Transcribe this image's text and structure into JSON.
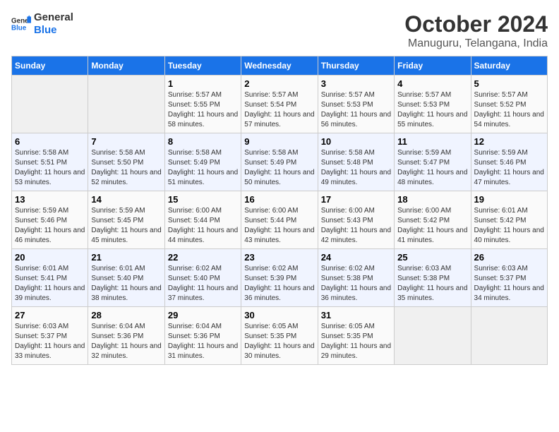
{
  "logo": {
    "general": "General",
    "blue": "Blue"
  },
  "header": {
    "month": "October 2024",
    "location": "Manuguru, Telangana, India"
  },
  "weekdays": [
    "Sunday",
    "Monday",
    "Tuesday",
    "Wednesday",
    "Thursday",
    "Friday",
    "Saturday"
  ],
  "weeks": [
    [
      {
        "day": "",
        "sunrise": "",
        "sunset": "",
        "daylight": ""
      },
      {
        "day": "",
        "sunrise": "",
        "sunset": "",
        "daylight": ""
      },
      {
        "day": "1",
        "sunrise": "Sunrise: 5:57 AM",
        "sunset": "Sunset: 5:55 PM",
        "daylight": "Daylight: 11 hours and 58 minutes."
      },
      {
        "day": "2",
        "sunrise": "Sunrise: 5:57 AM",
        "sunset": "Sunset: 5:54 PM",
        "daylight": "Daylight: 11 hours and 57 minutes."
      },
      {
        "day": "3",
        "sunrise": "Sunrise: 5:57 AM",
        "sunset": "Sunset: 5:53 PM",
        "daylight": "Daylight: 11 hours and 56 minutes."
      },
      {
        "day": "4",
        "sunrise": "Sunrise: 5:57 AM",
        "sunset": "Sunset: 5:53 PM",
        "daylight": "Daylight: 11 hours and 55 minutes."
      },
      {
        "day": "5",
        "sunrise": "Sunrise: 5:57 AM",
        "sunset": "Sunset: 5:52 PM",
        "daylight": "Daylight: 11 hours and 54 minutes."
      }
    ],
    [
      {
        "day": "6",
        "sunrise": "Sunrise: 5:58 AM",
        "sunset": "Sunset: 5:51 PM",
        "daylight": "Daylight: 11 hours and 53 minutes."
      },
      {
        "day": "7",
        "sunrise": "Sunrise: 5:58 AM",
        "sunset": "Sunset: 5:50 PM",
        "daylight": "Daylight: 11 hours and 52 minutes."
      },
      {
        "day": "8",
        "sunrise": "Sunrise: 5:58 AM",
        "sunset": "Sunset: 5:49 PM",
        "daylight": "Daylight: 11 hours and 51 minutes."
      },
      {
        "day": "9",
        "sunrise": "Sunrise: 5:58 AM",
        "sunset": "Sunset: 5:49 PM",
        "daylight": "Daylight: 11 hours and 50 minutes."
      },
      {
        "day": "10",
        "sunrise": "Sunrise: 5:58 AM",
        "sunset": "Sunset: 5:48 PM",
        "daylight": "Daylight: 11 hours and 49 minutes."
      },
      {
        "day": "11",
        "sunrise": "Sunrise: 5:59 AM",
        "sunset": "Sunset: 5:47 PM",
        "daylight": "Daylight: 11 hours and 48 minutes."
      },
      {
        "day": "12",
        "sunrise": "Sunrise: 5:59 AM",
        "sunset": "Sunset: 5:46 PM",
        "daylight": "Daylight: 11 hours and 47 minutes."
      }
    ],
    [
      {
        "day": "13",
        "sunrise": "Sunrise: 5:59 AM",
        "sunset": "Sunset: 5:46 PM",
        "daylight": "Daylight: 11 hours and 46 minutes."
      },
      {
        "day": "14",
        "sunrise": "Sunrise: 5:59 AM",
        "sunset": "Sunset: 5:45 PM",
        "daylight": "Daylight: 11 hours and 45 minutes."
      },
      {
        "day": "15",
        "sunrise": "Sunrise: 6:00 AM",
        "sunset": "Sunset: 5:44 PM",
        "daylight": "Daylight: 11 hours and 44 minutes."
      },
      {
        "day": "16",
        "sunrise": "Sunrise: 6:00 AM",
        "sunset": "Sunset: 5:44 PM",
        "daylight": "Daylight: 11 hours and 43 minutes."
      },
      {
        "day": "17",
        "sunrise": "Sunrise: 6:00 AM",
        "sunset": "Sunset: 5:43 PM",
        "daylight": "Daylight: 11 hours and 42 minutes."
      },
      {
        "day": "18",
        "sunrise": "Sunrise: 6:00 AM",
        "sunset": "Sunset: 5:42 PM",
        "daylight": "Daylight: 11 hours and 41 minutes."
      },
      {
        "day": "19",
        "sunrise": "Sunrise: 6:01 AM",
        "sunset": "Sunset: 5:42 PM",
        "daylight": "Daylight: 11 hours and 40 minutes."
      }
    ],
    [
      {
        "day": "20",
        "sunrise": "Sunrise: 6:01 AM",
        "sunset": "Sunset: 5:41 PM",
        "daylight": "Daylight: 11 hours and 39 minutes."
      },
      {
        "day": "21",
        "sunrise": "Sunrise: 6:01 AM",
        "sunset": "Sunset: 5:40 PM",
        "daylight": "Daylight: 11 hours and 38 minutes."
      },
      {
        "day": "22",
        "sunrise": "Sunrise: 6:02 AM",
        "sunset": "Sunset: 5:40 PM",
        "daylight": "Daylight: 11 hours and 37 minutes."
      },
      {
        "day": "23",
        "sunrise": "Sunrise: 6:02 AM",
        "sunset": "Sunset: 5:39 PM",
        "daylight": "Daylight: 11 hours and 36 minutes."
      },
      {
        "day": "24",
        "sunrise": "Sunrise: 6:02 AM",
        "sunset": "Sunset: 5:38 PM",
        "daylight": "Daylight: 11 hours and 36 minutes."
      },
      {
        "day": "25",
        "sunrise": "Sunrise: 6:03 AM",
        "sunset": "Sunset: 5:38 PM",
        "daylight": "Daylight: 11 hours and 35 minutes."
      },
      {
        "day": "26",
        "sunrise": "Sunrise: 6:03 AM",
        "sunset": "Sunset: 5:37 PM",
        "daylight": "Daylight: 11 hours and 34 minutes."
      }
    ],
    [
      {
        "day": "27",
        "sunrise": "Sunrise: 6:03 AM",
        "sunset": "Sunset: 5:37 PM",
        "daylight": "Daylight: 11 hours and 33 minutes."
      },
      {
        "day": "28",
        "sunrise": "Sunrise: 6:04 AM",
        "sunset": "Sunset: 5:36 PM",
        "daylight": "Daylight: 11 hours and 32 minutes."
      },
      {
        "day": "29",
        "sunrise": "Sunrise: 6:04 AM",
        "sunset": "Sunset: 5:36 PM",
        "daylight": "Daylight: 11 hours and 31 minutes."
      },
      {
        "day": "30",
        "sunrise": "Sunrise: 6:05 AM",
        "sunset": "Sunset: 5:35 PM",
        "daylight": "Daylight: 11 hours and 30 minutes."
      },
      {
        "day": "31",
        "sunrise": "Sunrise: 6:05 AM",
        "sunset": "Sunset: 5:35 PM",
        "daylight": "Daylight: 11 hours and 29 minutes."
      },
      {
        "day": "",
        "sunrise": "",
        "sunset": "",
        "daylight": ""
      },
      {
        "day": "",
        "sunrise": "",
        "sunset": "",
        "daylight": ""
      }
    ]
  ]
}
